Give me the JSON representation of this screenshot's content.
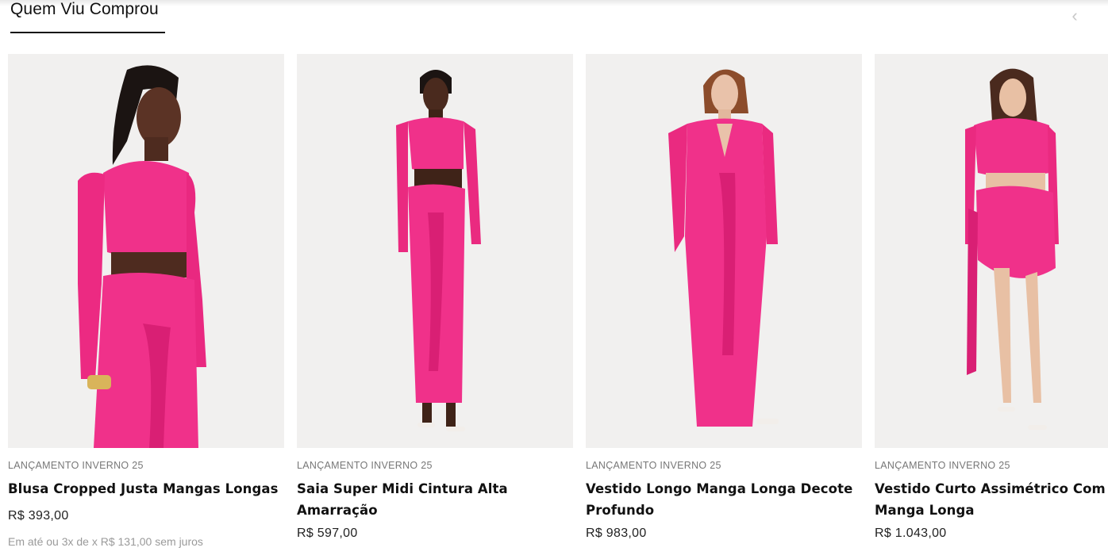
{
  "section": {
    "title": "Quem Viu Comprou",
    "prev_icon": "chevron-left-icon"
  },
  "colors": {
    "accent_pink": "#f0318a",
    "text": "#111111",
    "muted": "#777777"
  },
  "products": [
    {
      "collection": "LANÇAMENTO INVERNO 25",
      "name": "Blusa Cropped Justa Mangas Longas",
      "price": "R$ 393,00",
      "installments": "Em até ou 3x de x R$ 131,00 sem juros"
    },
    {
      "collection": "LANÇAMENTO INVERNO 25",
      "name": "Saia Super Midi Cintura Alta Amarração",
      "price": "R$ 597,00"
    },
    {
      "collection": "LANÇAMENTO INVERNO 25",
      "name": "Vestido Longo Manga Longa Decote Profundo",
      "price": "R$ 983,00"
    },
    {
      "collection": "LANÇAMENTO INVERNO 25",
      "name": "Vestido Curto Assimétrico Com Manga Longa",
      "price": "R$ 1.043,00"
    }
  ]
}
